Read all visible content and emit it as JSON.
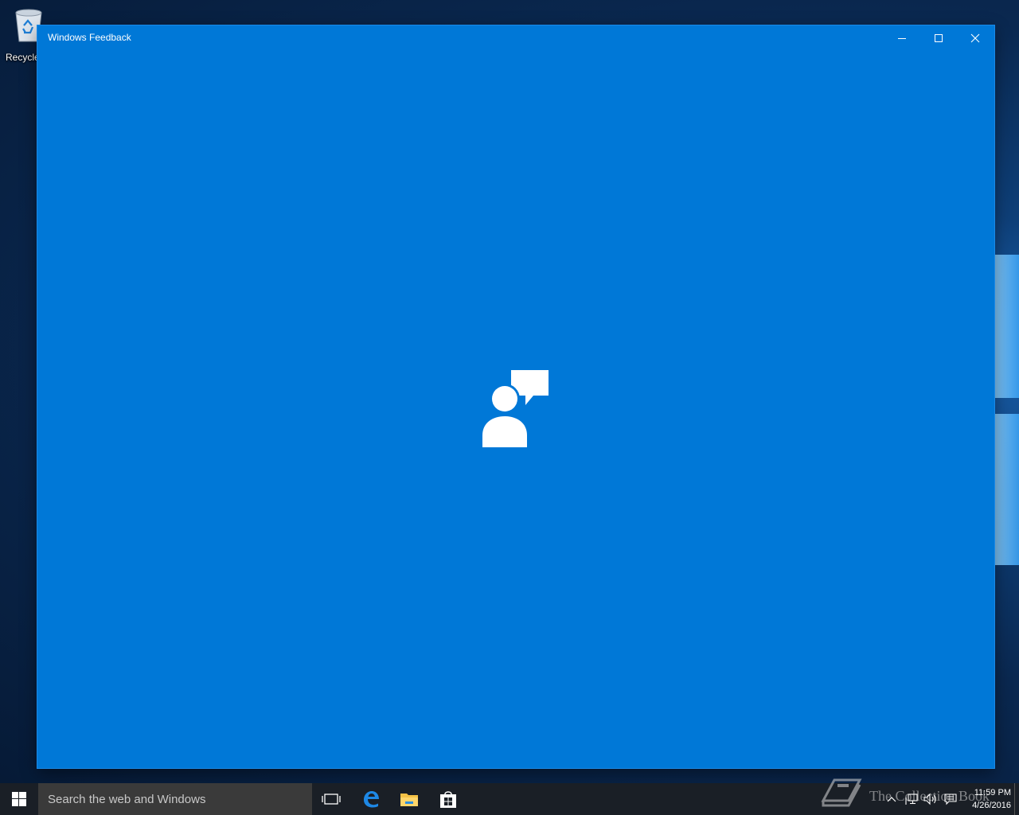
{
  "desktop": {
    "icons": [
      {
        "label": "Recycle",
        "icon": "recycle-bin-icon"
      }
    ]
  },
  "window": {
    "title": "Windows Feedback",
    "accent_color": "#0078d7",
    "splash_icon": "feedback-person-speech-icon",
    "controls": {
      "minimize": "minimize-icon",
      "maximize": "maximize-icon",
      "close": "close-icon"
    }
  },
  "taskbar": {
    "start_icon": "windows-start-icon",
    "search": {
      "placeholder": "Search the web and Windows"
    },
    "pinned": [
      {
        "name": "Task View",
        "icon": "task-view-icon"
      },
      {
        "name": "Microsoft Edge",
        "icon": "edge-icon"
      },
      {
        "name": "File Explorer",
        "icon": "folder-icon"
      },
      {
        "name": "Store",
        "icon": "store-icon"
      }
    ],
    "tray": {
      "icons": [
        "chevron-up-icon",
        "network-icon",
        "volume-icon",
        "action-center-icon"
      ],
      "time": "11:59 PM",
      "date": "4/26/2016"
    },
    "watermark": "The Collection Book"
  }
}
